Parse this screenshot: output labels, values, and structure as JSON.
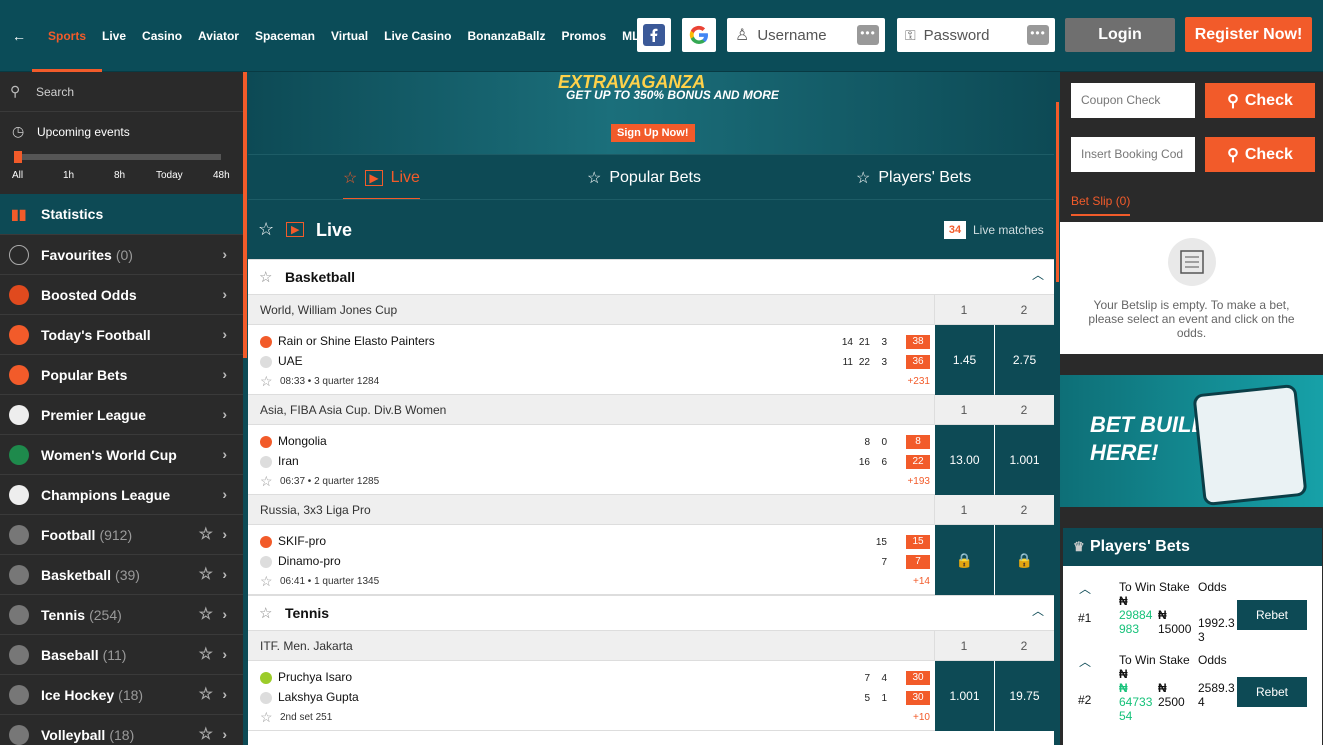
{
  "header": {
    "back_label": "←",
    "nav": [
      "Sports",
      "Live",
      "Casino",
      "Aviator",
      "Spaceman",
      "Virtual",
      "Live Casino",
      "BonanzaBallz",
      "Promos",
      "MLite"
    ],
    "username_placeholder": "Username",
    "password_placeholder": "Password",
    "dots": "•••",
    "login": "Login",
    "register": "Register Now!"
  },
  "sidebar": {
    "search": "Search",
    "upcoming": "Upcoming events",
    "time_labels": [
      "All",
      "1h",
      "8h",
      "Today",
      "48h"
    ],
    "statistics": "Statistics",
    "items": [
      {
        "label": "Favourites",
        "count": "(0)",
        "color": "#2a2a2a"
      },
      {
        "label": "Boosted Odds",
        "count": "",
        "color": "#e04a1e"
      },
      {
        "label": "Today's Football",
        "count": "",
        "color": "#f25b2a"
      },
      {
        "label": "Popular Bets",
        "count": "",
        "color": "#f25b2a"
      },
      {
        "label": "Premier League",
        "count": "",
        "color": "#eeeeee"
      },
      {
        "label": "Women's World Cup",
        "count": "",
        "color": "#1e8a4c"
      },
      {
        "label": "Champions League",
        "count": "",
        "color": "#eeeeee"
      },
      {
        "label": "Football",
        "count": "(912)",
        "color": "#777777"
      },
      {
        "label": "Basketball",
        "count": "(39)",
        "color": "#777777"
      },
      {
        "label": "Tennis",
        "count": "(254)",
        "color": "#777777"
      },
      {
        "label": "Baseball",
        "count": "(11)",
        "color": "#777777"
      },
      {
        "label": "Ice Hockey",
        "count": "(18)",
        "color": "#777777"
      },
      {
        "label": "Volleyball",
        "count": "(18)",
        "color": "#777777"
      }
    ]
  },
  "banner": {
    "t1": "EXTRAVAGANZA",
    "t2": "GET UP TO 350% BONUS AND MORE",
    "cta": "Sign Up Now!"
  },
  "tabs": {
    "live": "Live",
    "popular": "Popular Bets",
    "players": "Players' Bets"
  },
  "live": {
    "title": "Live",
    "count": "34",
    "count_label": "Live matches"
  },
  "basketball": {
    "name": "Basketball",
    "col1": "1",
    "col2": "2",
    "leagues": [
      {
        "name": "World, William Jones Cup",
        "home": "Rain or Shine Elasto Painters",
        "away": "UAE",
        "home_scores": [
          "14",
          "21",
          "3"
        ],
        "away_scores": [
          "11",
          "22",
          "3"
        ],
        "home_total": "38",
        "away_total": "36",
        "time": "08:33",
        "period": "3 quarter",
        "id": "1284",
        "more": "+231",
        "odd1": "1.45",
        "odd2": "2.75"
      },
      {
        "name": "Asia, FIBA Asia Cup. Div.B Women",
        "home": "Mongolia",
        "away": "Iran",
        "home_scores": [
          "8",
          "0"
        ],
        "away_scores": [
          "16",
          "6"
        ],
        "home_total": "8",
        "away_total": "22",
        "time": "06:37",
        "period": "2 quarter",
        "id": "1285",
        "more": "+193",
        "odd1": "13.00",
        "odd2": "1.001"
      },
      {
        "name": "Russia, 3x3 Liga Pro",
        "home": "SKIF-pro",
        "away": "Dinamo-pro",
        "home_scores": [
          "15"
        ],
        "away_scores": [
          "7"
        ],
        "home_total": "15",
        "away_total": "7",
        "time": "06:41",
        "period": "1 quarter",
        "id": "1345",
        "more": "+14",
        "odd1": "",
        "odd2": ""
      }
    ]
  },
  "tennis": {
    "name": "Tennis",
    "col1": "1",
    "col2": "2",
    "leagues": [
      {
        "name": "ITF. Men. Jakarta",
        "home": "Pruchya Isaro",
        "away": "Lakshya Gupta",
        "home_scores": [
          "7",
          "4"
        ],
        "away_scores": [
          "5",
          "1"
        ],
        "home_total": "30",
        "away_total": "30",
        "period": "2nd set",
        "id": "251",
        "more": "+10",
        "odd1": "1.001",
        "odd2": "19.75"
      }
    ]
  },
  "coupon": {
    "check_placeholder": "Coupon Check",
    "booking_placeholder": "Insert Booking Cod",
    "check": "Check"
  },
  "betslip": {
    "tab": "Bet Slip (0)",
    "empty": "Your Betslip is empty. To make a bet, please select an event and click on the odds."
  },
  "bet_builder": "BET BUILDER IS HERE!",
  "players_bets": {
    "title": "Players' Bets",
    "h_win": "To Win",
    "h_stake": "Stake",
    "h_odds": "Odds",
    "currency": "₦",
    "rebet": "Rebet",
    "rows": [
      {
        "rank": "#1",
        "win": "29884983",
        "stake": "15000",
        "odds": "1992.33"
      },
      {
        "rank": "#2",
        "win": "6473354",
        "stake": "2500",
        "odds": "2589.34"
      }
    ]
  }
}
